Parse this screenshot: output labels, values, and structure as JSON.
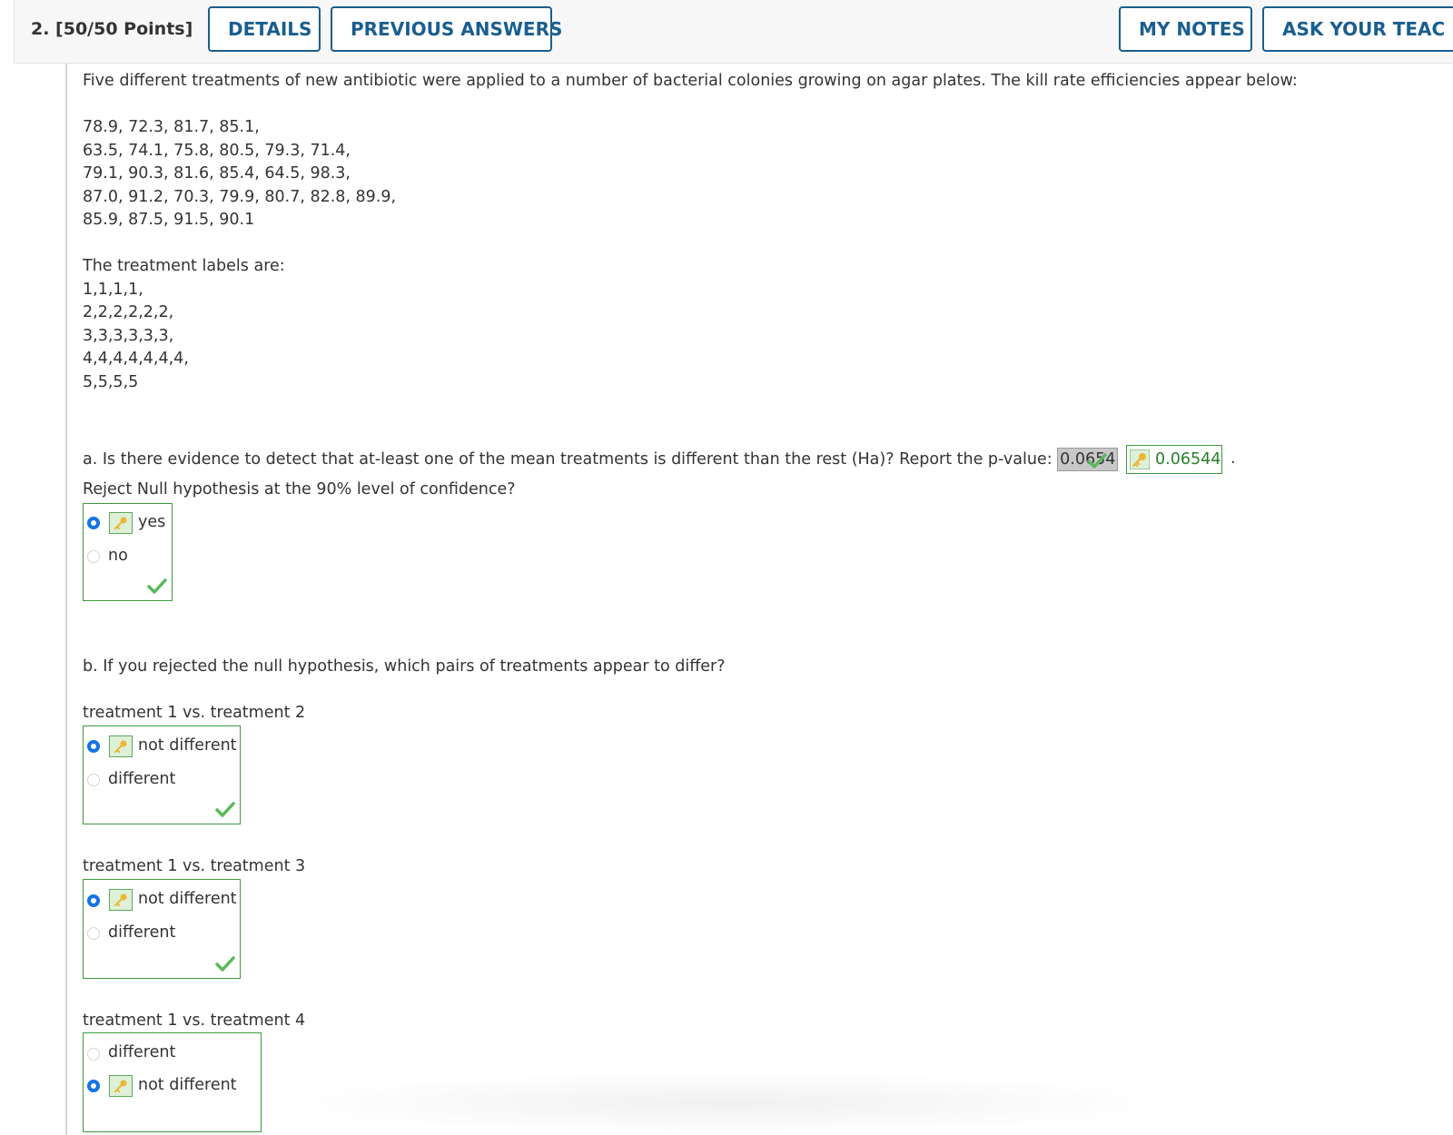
{
  "header": {
    "question_label": "2.  [50/50 Points]",
    "details_label": "DETAILS",
    "previous_answers_label": "PREVIOUS ANSWERS",
    "my_notes_label": "MY NOTES",
    "ask_teacher_label": "ASK YOUR TEAC"
  },
  "problem": {
    "intro": "Five different treatments of new antibiotic were applied to a number of bacterial colonies growing on agar plates. The kill rate efficiencies appear below:",
    "data_lines": [
      "78.9, 72.3, 81.7, 85.1,",
      "63.5, 74.1, 75.8, 80.5, 79.3, 71.4,",
      "79.1, 90.3, 81.6, 85.4, 64.5, 98.3,",
      "87.0, 91.2, 70.3, 79.9, 80.7, 82.8, 89.9,",
      "85.9, 87.5, 91.5, 90.1"
    ],
    "labels_heading": "The treatment labels are:",
    "label_lines": [
      "1,1,1,1,",
      "2,2,2,2,2,2,",
      "3,3,3,3,3,3,",
      "4,4,4,4,4,4,4,",
      "5,5,5,5"
    ]
  },
  "part_a": {
    "question": "a. Is there evidence to detect that at-least one of the mean treatments is different than the rest (Ha)? Report the p-value:",
    "entered_answer": "0.0654",
    "key_answer": "0.06544",
    "trailing": ".",
    "reject_question": "Reject Null hypothesis at the 90% level of confidence?",
    "options": [
      "yes",
      "no"
    ],
    "selected": "yes"
  },
  "part_b": {
    "question": "b. If you rejected the null hypothesis, which pairs of treatments appear to differ?",
    "comparisons": [
      {
        "label": "treatment 1 vs. treatment 2",
        "options": [
          "not different",
          "different"
        ],
        "selected": "not different"
      },
      {
        "label": "treatment 1 vs. treatment 3",
        "options": [
          "not different",
          "different"
        ],
        "selected": "not different"
      },
      {
        "label": "treatment 1 vs. treatment 4",
        "options": [
          "different",
          "not different"
        ],
        "selected": "not different"
      }
    ]
  },
  "colors": {
    "link_blue": "#1a5e8f",
    "correct_green": "#3d9a3d",
    "radio_blue": "#1573e6"
  }
}
